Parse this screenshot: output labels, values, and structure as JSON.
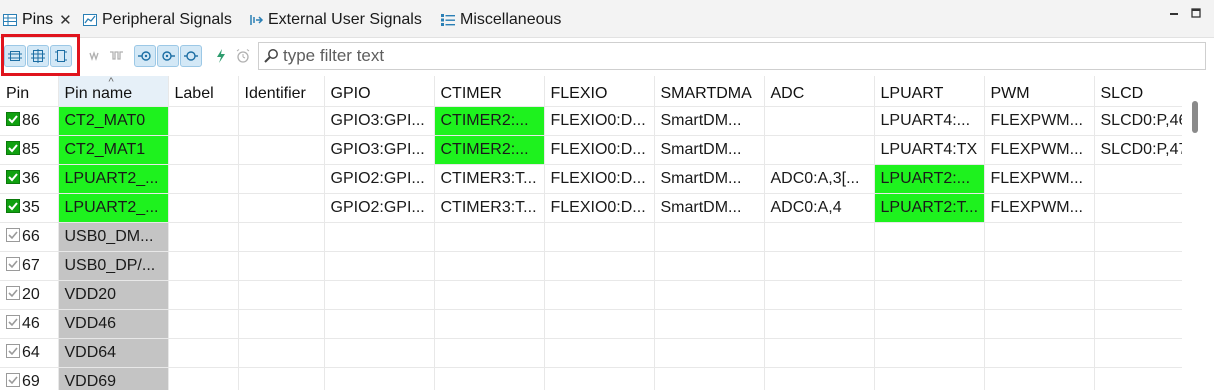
{
  "tabs": [
    {
      "label": "Pins",
      "icon": "table-icon",
      "active": true
    },
    {
      "label": "Peripheral Signals",
      "icon": "signal-chart-icon"
    },
    {
      "label": "External User Signals",
      "icon": "external-signal-icon"
    },
    {
      "label": "Miscellaneous",
      "icon": "list-icon"
    }
  ],
  "filter": {
    "placeholder": "type filter text"
  },
  "columns": [
    "Pin",
    "Pin name",
    "Label",
    "Identifier",
    "GPIO",
    "CTIMER",
    "FLEXIO",
    "SMARTDMA",
    "ADC",
    "LPUART",
    "PWM",
    "SLCD"
  ],
  "rows": [
    {
      "pin": "86",
      "checked": "strong",
      "cells": [
        "CT2_MAT0",
        "",
        "",
        "GPIO3:GPI...",
        "CTIMER2:...",
        "FLEXIO0:D...",
        "SmartDM...",
        "",
        "LPUART4:...",
        "FLEXPWM...",
        "SLCD0:P,46"
      ],
      "colors": [
        "green",
        "",
        "",
        "",
        "green",
        "",
        "",
        "",
        "",
        "",
        ""
      ]
    },
    {
      "pin": "85",
      "checked": "strong",
      "cells": [
        "CT2_MAT1",
        "",
        "",
        "GPIO3:GPI...",
        "CTIMER2:...",
        "FLEXIO0:D...",
        "SmartDM...",
        "",
        "LPUART4:TX",
        "FLEXPWM...",
        "SLCD0:P,47"
      ],
      "colors": [
        "green",
        "",
        "",
        "",
        "green",
        "",
        "",
        "",
        "",
        "",
        ""
      ]
    },
    {
      "pin": "36",
      "checked": "strong",
      "cells": [
        "LPUART2_...",
        "",
        "",
        "GPIO2:GPI...",
        "CTIMER3:T...",
        "FLEXIO0:D...",
        "SmartDM...",
        "ADC0:A,3[...",
        "LPUART2:...",
        "FLEXPWM...",
        ""
      ],
      "colors": [
        "green",
        "",
        "",
        "",
        "",
        "",
        "",
        "",
        "green",
        "",
        ""
      ]
    },
    {
      "pin": "35",
      "checked": "strong",
      "cells": [
        "LPUART2_...",
        "",
        "",
        "GPIO2:GPI...",
        "CTIMER3:T...",
        "FLEXIO0:D...",
        "SmartDM...",
        "ADC0:A,4",
        "LPUART2:T...",
        "FLEXPWM...",
        ""
      ],
      "colors": [
        "green",
        "",
        "",
        "",
        "",
        "",
        "",
        "",
        "green",
        "",
        ""
      ]
    },
    {
      "pin": "66",
      "checked": "light",
      "cells": [
        "USB0_DM...",
        "",
        "",
        "",
        "",
        "",
        "",
        "",
        "",
        "",
        ""
      ],
      "colors": [
        "gray",
        "",
        "",
        "",
        "",
        "",
        "",
        "",
        "",
        "",
        ""
      ]
    },
    {
      "pin": "67",
      "checked": "light",
      "cells": [
        "USB0_DP/...",
        "",
        "",
        "",
        "",
        "",
        "",
        "",
        "",
        "",
        ""
      ],
      "colors": [
        "gray",
        "",
        "",
        "",
        "",
        "",
        "",
        "",
        "",
        "",
        ""
      ]
    },
    {
      "pin": "20",
      "checked": "light",
      "cells": [
        "VDD20",
        "",
        "",
        "",
        "",
        "",
        "",
        "",
        "",
        "",
        ""
      ],
      "colors": [
        "gray",
        "",
        "",
        "",
        "",
        "",
        "",
        "",
        "",
        "",
        ""
      ]
    },
    {
      "pin": "46",
      "checked": "light",
      "cells": [
        "VDD46",
        "",
        "",
        "",
        "",
        "",
        "",
        "",
        "",
        "",
        ""
      ],
      "colors": [
        "gray",
        "",
        "",
        "",
        "",
        "",
        "",
        "",
        "",
        "",
        ""
      ]
    },
    {
      "pin": "64",
      "checked": "light",
      "cells": [
        "VDD64",
        "",
        "",
        "",
        "",
        "",
        "",
        "",
        "",
        "",
        ""
      ],
      "colors": [
        "gray",
        "",
        "",
        "",
        "",
        "",
        "",
        "",
        "",
        "",
        ""
      ]
    },
    {
      "pin": "69",
      "checked": "light",
      "cells": [
        "VDD69",
        "",
        "",
        "",
        "",
        "",
        "",
        "",
        "",
        "",
        ""
      ],
      "colors": [
        "gray",
        "",
        "",
        "",
        "",
        "",
        "",
        "",
        "",
        "",
        ""
      ]
    }
  ],
  "colors": {
    "green": "#1ef21e",
    "gray": "#c4c4c4",
    "accent": "#1c8fd6",
    "highlight": "#e0141d"
  }
}
